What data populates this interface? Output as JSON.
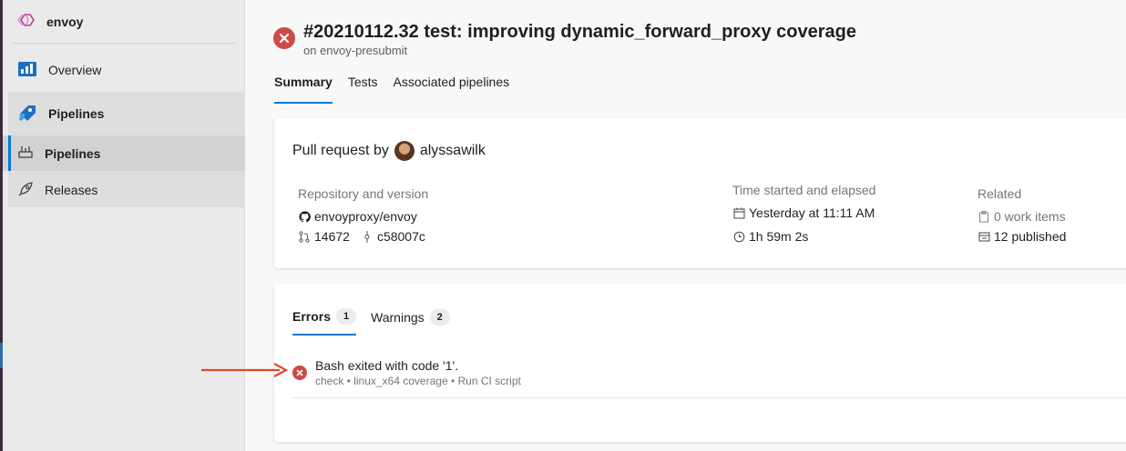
{
  "colors": {
    "accent": "#0078d4",
    "error": "#cd4a45",
    "annotation_arrow": "#e8462a",
    "project_logo": "#b4479b"
  },
  "sidebar": {
    "project_name": "envoy",
    "project_icon": "envoy-logo-icon",
    "items": [
      {
        "label": "Overview",
        "icon": "overview-icon"
      },
      {
        "label": "Pipelines",
        "icon": "pipelines-icon"
      },
      {
        "label": "Pipelines",
        "icon": "pipelines-sub-icon",
        "selected": true
      },
      {
        "label": "Releases",
        "icon": "rocket-icon"
      }
    ]
  },
  "header": {
    "title": "#20210112.32 test: improving dynamic_forward_proxy coverage",
    "subtitle": "on envoy-presubmit",
    "status_icon": "failed-icon"
  },
  "tabs": [
    {
      "label": "Summary",
      "active": true
    },
    {
      "label": "Tests",
      "active": false
    },
    {
      "label": "Associated pipelines",
      "active": false
    }
  ],
  "summary": {
    "pr_prefix": "Pull request by",
    "author": "alyssawilk",
    "repository": {
      "header": "Repository and version",
      "repo": "envoyproxy/envoy",
      "pr_number": "14672",
      "commit": "c58007c"
    },
    "time": {
      "header": "Time started and elapsed",
      "started": "Yesterday at 11:11 AM",
      "elapsed": "1h 59m 2s"
    },
    "related": {
      "header": "Related",
      "work_items": "0 work items",
      "published": "12 published"
    }
  },
  "issues": {
    "tabs": [
      {
        "label": "Errors",
        "count": "1",
        "active": true
      },
      {
        "label": "Warnings",
        "count": "2",
        "active": false
      }
    ],
    "items": [
      {
        "message": "Bash exited with code '1'.",
        "context": "check • linux_x64 coverage • Run CI script"
      }
    ]
  }
}
